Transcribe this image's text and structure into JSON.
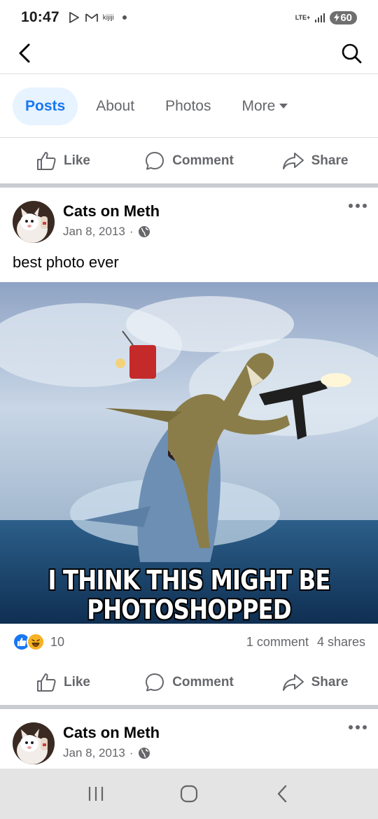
{
  "status_bar": {
    "time": "10:47",
    "kijiji": "kijiji",
    "network": "LTE+",
    "battery": "60"
  },
  "tabs": [
    {
      "label": "Posts",
      "active": true
    },
    {
      "label": "About",
      "active": false
    },
    {
      "label": "Photos",
      "active": false
    },
    {
      "label": "More",
      "active": false
    }
  ],
  "actions": {
    "like": "Like",
    "comment": "Comment",
    "share": "Share"
  },
  "posts": [
    {
      "author": "Cats on Meth",
      "date": "Jan 8, 2013",
      "separator": "·",
      "text": "best photo ever",
      "image_caption_line1": "I THINK THIS MIGHT BE",
      "image_caption_line2": "PHOTOSHOPPED",
      "reaction_count": "10",
      "comments": "1 comment",
      "shares": "4 shares"
    },
    {
      "author": "Cats on Meth",
      "date": "Jan 8, 2013",
      "separator": "·"
    }
  ],
  "colors": {
    "accent": "#1877f2",
    "tab_active_bg": "#e7f3ff",
    "secondary_text": "#65676b",
    "like_blue": "#1877f2",
    "haha_yellow": "#f7b125"
  },
  "icons": [
    "back-arrow-icon",
    "search-icon",
    "like-thumb-icon",
    "comment-bubble-icon",
    "share-arrow-icon",
    "globe-icon",
    "more-dots-icon"
  ]
}
